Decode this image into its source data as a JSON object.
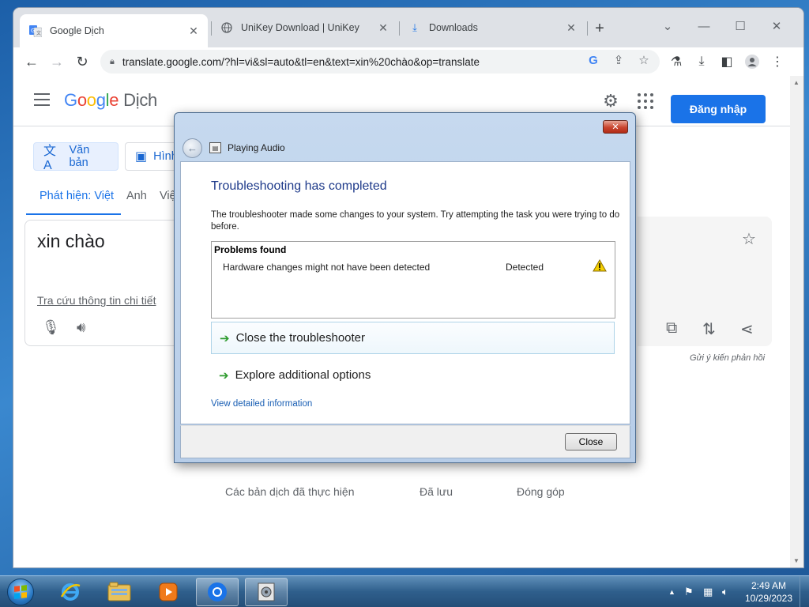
{
  "browser": {
    "tabs": [
      {
        "title": "Google Dịch",
        "icon": "google-translate-icon",
        "active": true
      },
      {
        "title": "UniKey Download | UniKey",
        "icon": "globe-icon",
        "active": false
      },
      {
        "title": "Downloads",
        "icon": "download-icon",
        "active": false
      }
    ],
    "url": "translate.google.com/?hl=vi&sl=auto&tl=en&text=xin%20chào&op=translate"
  },
  "gt": {
    "logo_google": [
      "G",
      "o",
      "o",
      "g",
      "l",
      "e"
    ],
    "logo_suffix": "Dịch",
    "signin_label": "Đăng nhập",
    "mode_text": "Văn bản",
    "mode_image": "Hình",
    "lang_detect": "Phát hiện: Việt",
    "lang_anh": "Anh",
    "lang_viet": "Việ",
    "source_text": "xin chào",
    "lookup_link": "Tra cứu thông tin chi tiết",
    "feedback": "Gửi ý kiến phản hồi",
    "bottom_history": "Các bản dịch đã thực hiện",
    "bottom_saved": "Đã lưu",
    "bottom_contribute": "Đóng góp"
  },
  "dialog": {
    "window_title": "Playing Audio",
    "heading": "Troubleshooting has completed",
    "description": "The troubleshooter made some changes to your system. Try attempting the task you were trying to do before.",
    "problems_header": "Problems found",
    "problems": [
      {
        "name": "Hardware changes might not have been detected",
        "status": "Detected",
        "icon": "warning-icon"
      }
    ],
    "option_close": "Close the troubleshooter",
    "option_explore": "Explore additional options",
    "detail_link": "View detailed information",
    "close_button": "Close"
  },
  "taskbar": {
    "time": "2:49 AM",
    "date": "10/29/2023"
  },
  "colors": {
    "google_blue": "#1a73e8",
    "dialog_heading": "#1e3a8a",
    "taskbar": "#2f5f8c"
  }
}
